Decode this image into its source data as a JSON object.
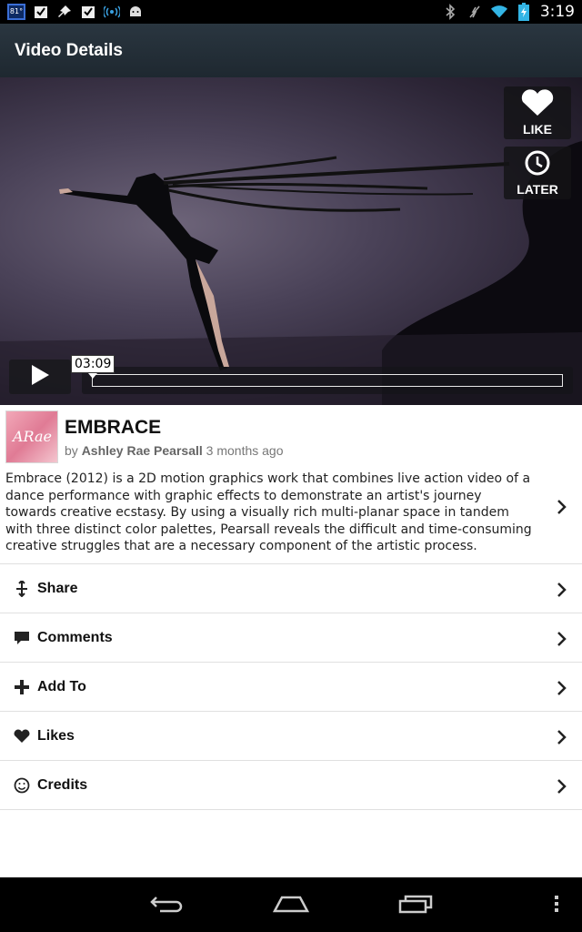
{
  "status_bar": {
    "temperature": "81°",
    "time": "3:19",
    "left_icons": [
      "checkbox-icon",
      "pin-icon",
      "checkbox-icon",
      "wireless-icon",
      "android-icon"
    ],
    "right_icons": [
      "bluetooth-icon",
      "mute-icon",
      "wifi-icon",
      "battery-icon"
    ]
  },
  "action_bar": {
    "title": "Video Details"
  },
  "player": {
    "like_label": "LIKE",
    "later_label": "LATER",
    "time_tooltip": "03:09",
    "progress_fraction": 0.0
  },
  "video": {
    "title": "EMBRACE",
    "by": "by",
    "author": "Ashley Rae Pearsall",
    "age": "3 months ago",
    "thumb_text": "ARae",
    "description": "Embrace (2012) is a 2D motion graphics work that combines live action video of a dance performance with graphic effects to demonstrate an artist's journey towards creative ecstasy. By using a visually rich multi-planar space in tandem with three distinct color palettes, Pearsall reveals the difficult and time-consuming creative struggles that are a necessary component of the artistic process."
  },
  "menu": [
    {
      "label": "Share",
      "icon": "share-icon"
    },
    {
      "label": "Comments",
      "icon": "comment-icon"
    },
    {
      "label": "Add To",
      "icon": "plus-icon"
    },
    {
      "label": "Likes",
      "icon": "heart-icon"
    },
    {
      "label": "Credits",
      "icon": "smiley-icon"
    }
  ],
  "nav_bar": {
    "buttons": [
      "back-icon",
      "home-icon",
      "recent-apps-icon",
      "menu-icon"
    ]
  }
}
